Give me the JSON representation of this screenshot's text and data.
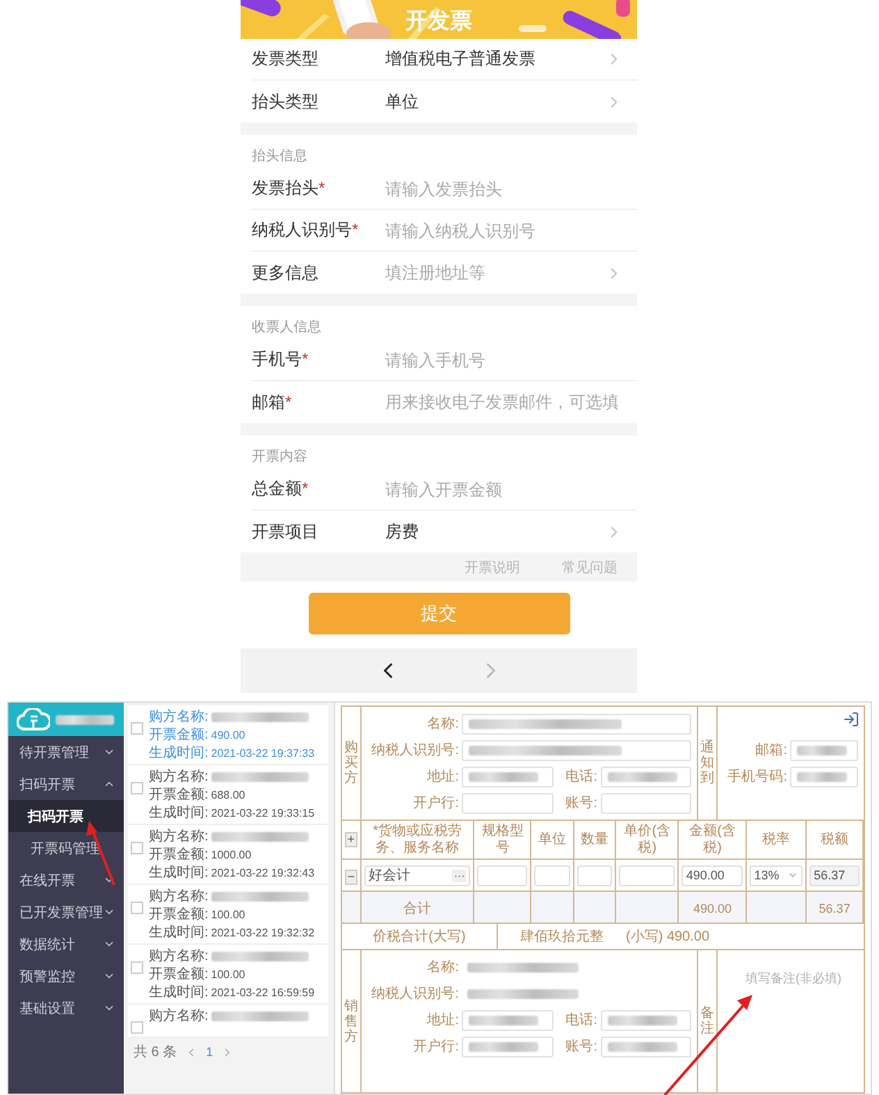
{
  "mobile": {
    "banner_title": "开发票",
    "sections": [
      {
        "rows": [
          {
            "label": "发票类型",
            "kind": "select",
            "value": "增值税电子普通发票"
          },
          {
            "label": "抬头类型",
            "kind": "select",
            "value": "单位"
          }
        ]
      },
      {
        "header": "抬头信息",
        "rows": [
          {
            "label": "发票抬头",
            "required_mark": "*",
            "kind": "input",
            "placeholder": "请输入发票抬头"
          },
          {
            "label": "纳税人识别号",
            "required_mark": "*",
            "kind": "input",
            "placeholder": "请输入纳税人识别号"
          },
          {
            "label": "更多信息",
            "kind": "select",
            "placeholder": "填注册地址等"
          }
        ]
      },
      {
        "header": "收票人信息",
        "rows": [
          {
            "label": "手机号",
            "required_mark": "*",
            "kind": "input",
            "placeholder": "请输入手机号"
          },
          {
            "label": "邮箱",
            "required_mark": "*",
            "kind": "input",
            "placeholder": "用来接收电子发票邮件，可选填"
          }
        ]
      },
      {
        "header": "开票内容",
        "rows": [
          {
            "label": "总金额",
            "required_mark": "*",
            "kind": "input",
            "placeholder": "请输入开票金额"
          },
          {
            "label": "开票项目",
            "kind": "select",
            "value": "房费"
          }
        ]
      }
    ],
    "footer_links": [
      "开票说明",
      "常见问题"
    ],
    "submit_button": "提交",
    "nav": [
      {
        "kind": "back",
        "disabled": false
      },
      {
        "kind": "forward",
        "disabled": true
      }
    ]
  },
  "desktop": {
    "sidebar": {
      "items": [
        {
          "label": "待开票管理",
          "expanded": false
        },
        {
          "label": "扫码开票",
          "expanded": true,
          "children": [
            {
              "label": "扫码开票",
              "selected": true
            },
            {
              "label": "开票码管理",
              "selected": false
            }
          ]
        },
        {
          "label": "在线开票",
          "expanded": false
        },
        {
          "label": "已开发票管理",
          "expanded": false
        },
        {
          "label": "数据统计",
          "expanded": false
        },
        {
          "label": "预警监控",
          "expanded": false
        },
        {
          "label": "基础设置",
          "expanded": false
        }
      ]
    },
    "list": {
      "entries": [
        {
          "buyer_label": "购方名称:",
          "amount_label": "开票金额:",
          "amount": "490.00",
          "time_label": "生成时间:",
          "time": "2021-03-22 19:37:33",
          "selected": true,
          "checked": false
        },
        {
          "buyer_label": "购方名称:",
          "amount_label": "开票金额:",
          "amount": "688.00",
          "time_label": "生成时间:",
          "time": "2021-03-22 19:33:15",
          "selected": false,
          "checked": false
        },
        {
          "buyer_label": "购方名称:",
          "amount_label": "开票金额:",
          "amount": "1000.00",
          "time_label": "生成时间:",
          "time": "2021-03-22 19:32:43",
          "selected": false,
          "checked": false
        },
        {
          "buyer_label": "购方名称:",
          "amount_label": "开票金额:",
          "amount": "100.00",
          "time_label": "生成时间:",
          "time": "2021-03-22 19:32:32",
          "selected": false,
          "checked": false
        },
        {
          "buyer_label": "购方名称:",
          "amount_label": "开票金额:",
          "amount": "100.00",
          "time_label": "生成时间:",
          "time": "2021-03-22 16:59:59",
          "selected": false,
          "checked": false
        },
        {
          "buyer_label": "购方名称:",
          "selected": false,
          "checked": false
        }
      ],
      "pagination": {
        "total": "共 6 条",
        "pages": [
          {
            "label": "1",
            "selected": true
          }
        ]
      }
    },
    "invoice": {
      "buyer": {
        "side_label": "购买方",
        "rows": [
          [
            {
              "label": "名称:",
              "kind": "boxed",
              "blurred": true
            }
          ],
          [
            {
              "label": "纳税人识别号:",
              "kind": "boxed",
              "blurred": true
            }
          ],
          [
            {
              "label": "地址:",
              "kind": "boxed",
              "blurred": true
            },
            {
              "label": "电话:",
              "kind": "boxed",
              "blurred": true
            }
          ],
          [
            {
              "label": "开户行:",
              "kind": "boxed",
              "blurred": false
            },
            {
              "label": "账号:",
              "kind": "boxed",
              "blurred": false
            }
          ]
        ]
      },
      "notify": {
        "side_label": "通知到",
        "fields": [
          {
            "label": "邮箱:",
            "blurred": true
          },
          {
            "label": "手机号码:",
            "blurred": true
          }
        ]
      },
      "table": {
        "add_symbol": "+",
        "columns": [
          "*货物或应税劳务、服务名称",
          "规格型号",
          "单位",
          "数量",
          "单价(含税)",
          "金额(含税)",
          "税率",
          "税额"
        ],
        "rows": [
          {
            "remove_symbol": "−",
            "name": "好会计",
            "more": "···",
            "amount": "490.00",
            "tax_rate": "13%",
            "tax": "56.37"
          }
        ],
        "total": {
          "label": "合计",
          "amount": "490.00",
          "tax": "56.37"
        },
        "grand_total": {
          "label": "价税合计(大写)",
          "in_words": "肆佰玖拾元整",
          "in_figures": "(小写) 490.00"
        }
      },
      "seller": {
        "side_label": "销售方",
        "rows": [
          [
            {
              "label": "名称:",
              "kind": "plain",
              "blurred": true
            }
          ],
          [
            {
              "label": "纳税人识别号:",
              "kind": "plain",
              "blurred": true
            }
          ],
          [
            {
              "label": "地址:",
              "kind": "boxed",
              "blurred": true
            },
            {
              "label": "电话:",
              "kind": "boxed",
              "blurred": true
            }
          ],
          [
            {
              "label": "开户行:",
              "kind": "boxed",
              "blurred": true
            },
            {
              "label": "账号:",
              "kind": "boxed",
              "blurred": true
            }
          ]
        ]
      },
      "remarks": {
        "side_label": "备注",
        "placeholder": "填写备注(非必填)"
      }
    }
  }
}
